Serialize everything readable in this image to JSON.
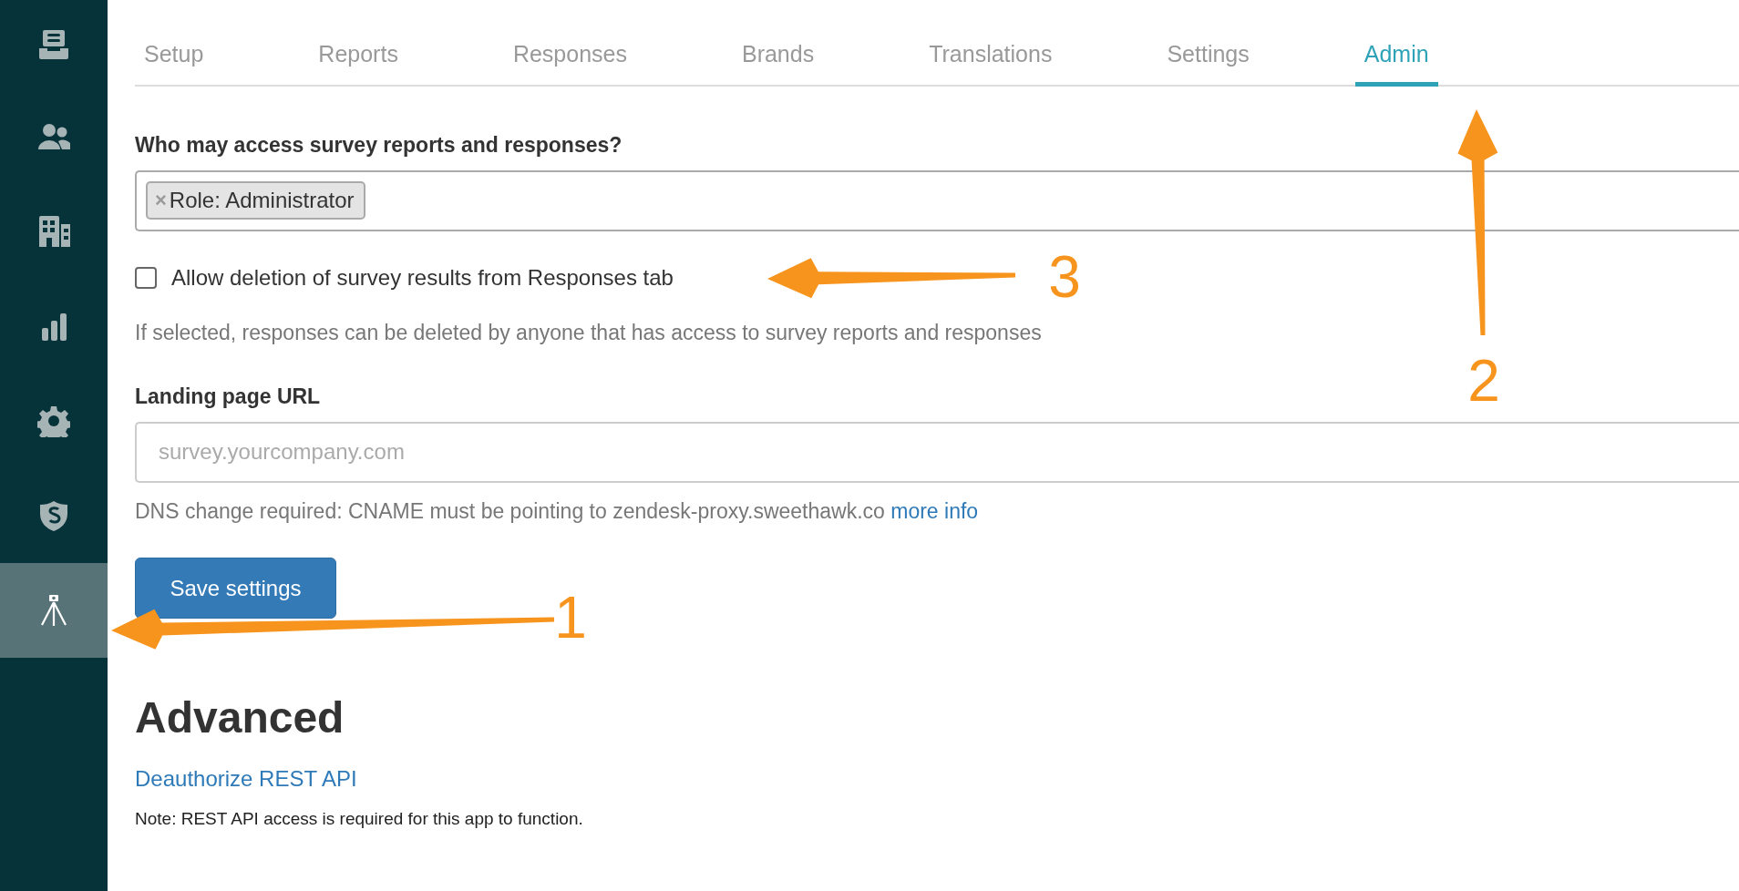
{
  "sidebar": {
    "items": [
      {
        "selected": false
      },
      {
        "selected": false
      },
      {
        "selected": false
      },
      {
        "selected": false
      },
      {
        "selected": false
      },
      {
        "selected": false
      },
      {
        "selected": true
      }
    ]
  },
  "tabs": [
    {
      "label": "Setup",
      "selected": false
    },
    {
      "label": "Reports",
      "selected": false
    },
    {
      "label": "Responses",
      "selected": false
    },
    {
      "label": "Brands",
      "selected": false
    },
    {
      "label": "Translations",
      "selected": false
    },
    {
      "label": "Settings",
      "selected": false
    },
    {
      "label": "Admin",
      "selected": true
    }
  ],
  "access": {
    "label": "Who may access survey reports and responses?",
    "tags": [
      {
        "remove": "×",
        "label": "Role: Administrator"
      }
    ]
  },
  "allow_deletion": {
    "label": "Allow deletion of survey results from Responses tab",
    "checked": false,
    "help": "If selected, responses can be deleted by anyone that has access to survey reports and responses"
  },
  "landing_page": {
    "label": "Landing page URL",
    "placeholder": "survey.yourcompany.com",
    "help": "DNS change required: CNAME must be pointing to zendesk-proxy.sweethawk.co",
    "help_link": "more info"
  },
  "save_button": "Save settings",
  "advanced": {
    "heading": "Advanced",
    "link": "Deauthorize REST API",
    "note": "Note: REST API access is required for this app to function."
  },
  "annotations": [
    {
      "number": "1"
    },
    {
      "number": "2"
    },
    {
      "number": "3"
    }
  ]
}
